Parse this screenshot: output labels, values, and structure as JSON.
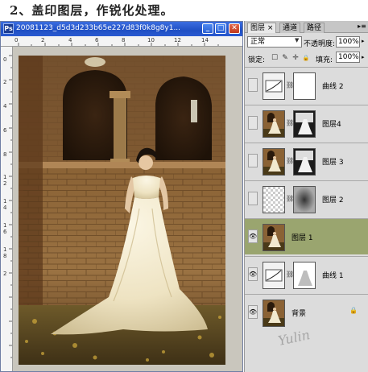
{
  "heading": "2、盖印图层，作锐化处理。",
  "document": {
    "title": "20081123_d5d3d233b65e227d83f0k8g8y1...",
    "ruler_top_labels": [
      "0",
      "2",
      "4",
      "6",
      "8",
      "10",
      "12",
      "14"
    ],
    "ruler_left_labels": [
      "0",
      "2",
      "4",
      "6",
      "8",
      "1",
      "2",
      "1",
      "4",
      "1",
      "6",
      "1",
      "8",
      "2"
    ],
    "buttons": {
      "minimize": "_",
      "maximize": "□",
      "close": "✕"
    }
  },
  "layers_panel": {
    "tabs": [
      "图层 ×",
      "通道",
      "路径"
    ],
    "blend_mode": "正常",
    "opacity_label": "不透明度:",
    "opacity_value": "100%",
    "lock_label": "锁定:",
    "lock_icons": [
      "☐",
      "✎",
      "✛",
      "🔒"
    ],
    "fill_label": "填充:",
    "fill_value": "100%",
    "layers": [
      {
        "name": "曲线 2",
        "visible": false,
        "selected": false,
        "thumb_type": "curves",
        "mask_type": "white",
        "locked": false
      },
      {
        "name": "图层4",
        "visible": false,
        "selected": false,
        "thumb_type": "photo",
        "mask_type": "dark-figure",
        "locked": false
      },
      {
        "name": "图层 3",
        "visible": false,
        "selected": false,
        "thumb_type": "photo",
        "mask_type": "dark-figure",
        "locked": false
      },
      {
        "name": "图层 2",
        "visible": false,
        "selected": false,
        "thumb_type": "transparent",
        "mask_type": "gray-blur",
        "locked": false
      },
      {
        "name": "图层 1",
        "visible": true,
        "selected": true,
        "thumb_type": "photo",
        "mask_type": "none",
        "locked": false
      },
      {
        "name": "曲线 1",
        "visible": true,
        "selected": false,
        "thumb_type": "curves",
        "mask_type": "light-figure",
        "locked": false
      },
      {
        "name": "背景",
        "visible": true,
        "selected": false,
        "thumb_type": "photo",
        "mask_type": "none",
        "locked": true
      }
    ]
  },
  "colors": {
    "titlebar": "#2a5bd1",
    "selected_layer": "#9aa56f",
    "panel_bg": "#dcdcdc"
  }
}
